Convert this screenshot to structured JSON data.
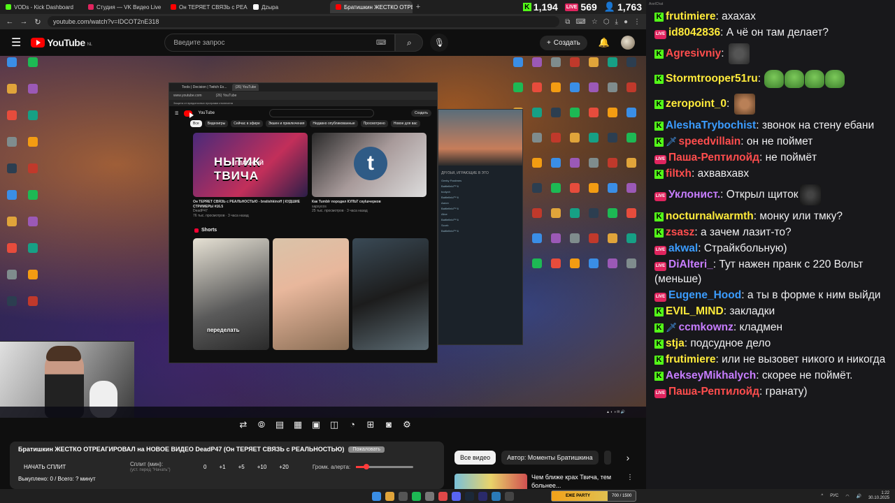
{
  "tabs": [
    {
      "label": "VODs - Kick Dashboard",
      "color": "#53fc18",
      "active": false
    },
    {
      "label": "Студия — VK Видео Live",
      "color": "#e0245e",
      "active": false
    },
    {
      "label": "Он ТЕРЯЕТ СВЯЗЬ с РЕАЛЬНОСТЬ",
      "color": "#ff0000",
      "active": false
    },
    {
      "label": "Дzырa",
      "color": "#ffffff",
      "active": false
    },
    {
      "label": "Братишкин ЖЕСТКО ОТРЕ",
      "color": "#ff0000",
      "active": true
    }
  ],
  "counters": {
    "kick": "1,194",
    "vk": "569",
    "viewers": "1,763",
    "vk_badge": "LIVE"
  },
  "address": {
    "url": "youtube.com/watch?v=IDCOT2nE318"
  },
  "youtube": {
    "logo": "YouTube",
    "region": "NL",
    "search_placeholder": "Введите запрос",
    "create_label": "Создать"
  },
  "inner_browser": {
    "tabs": [
      "Tools | Decision | Twitch Ex...",
      "(26) YouTube"
    ],
    "url": "www.youtube.com",
    "page_title": "(26) YouTube",
    "note": "Защита от вредоносных программ отключена",
    "chips": [
      "Все",
      "Видеоигры",
      "Сейчас в эфире",
      "Экшен и приключения",
      "Недавно опубликованные",
      "Просмотрено",
      "Новое для вас"
    ],
    "thumb1_text": "НЫТИК ТВИЧА",
    "thumb1_top": "ГЛАВНЫЙ",
    "video1_title": "Он ТЕРЯЕТ СВЯЗЬ с РЕАЛЬНОСТЬЮ - bratishkinoff | КУДШИЕ СТРИМЕРЫ #16.5",
    "video1_channel": "DeadP47",
    "video1_stats": "76 тыс. просмотров · 3 часа назад",
    "video2_title": "Как Tumblr породил КУЛЬТ скуlшчерков",
    "video2_channel": "sapsycos",
    "video2_stats": "25 тыс. просмотров · 3 часа назад",
    "shorts_label": "Shorts",
    "short_caption": "переделать"
  },
  "steam": {
    "heading": "ДРУЗЬЯ, ИГРАЮЩИЕ В ЭТО",
    "friends": [
      "Geeky Pastimes",
      "Battlefield™ 6",
      "bodych",
      "Battlefield™ 6",
      "Aaron",
      "Battlefield™ 6",
      "Alice",
      "Battlefield™ 6",
      "Scorb",
      "Battlefield™ 6"
    ]
  },
  "video": {
    "title": "Братишкин ЖЕСТКО ОТРЕАГИРОВАЛ на НОВОЕ ВИДЕО DeadP47 (Он ТЕРЯЕТ СВЯЗЬ с РЕАЛЬНОСТЬЮ)",
    "badge": "Пожаловать"
  },
  "split": {
    "start_label": "НАЧАТЬ СПЛИТ",
    "label": "Сплит (мин):",
    "sub": "(уст. перед \"Начать\")",
    "values": [
      "0",
      "+1",
      "+5",
      "+10",
      "+20"
    ],
    "alert_label": "Громк. алерта:",
    "alert_level": 0.18,
    "skip_text": "Выкуплено: 0 / Всего: ? минут"
  },
  "filters": {
    "all": "Все видео",
    "author": "Автор: Моменты Братишкина"
  },
  "recommended": {
    "title": "Чем ближе крах Твича, тем больнее..."
  },
  "chat": {
    "title": "AxelChat",
    "messages": [
      {
        "platform": "kick",
        "user": "frutimiere",
        "color": "#ffeb3b",
        "text": "ахахах"
      },
      {
        "platform": "vk",
        "user": "id8042836",
        "color": "#ffeb3b",
        "text": "А чё он там делает?"
      },
      {
        "platform": "kick",
        "user": "Agresivniy",
        "color": "#ff4d4d",
        "text": "",
        "emote": "dog"
      },
      {
        "platform": "kick",
        "user": "Stormtrooper51ru",
        "color": "#ffeb3b",
        "text": "",
        "emote": "frogs"
      },
      {
        "platform": "kick",
        "user": "zeropoint_0",
        "color": "#ffeb3b",
        "text": "",
        "emote": "face"
      },
      {
        "platform": "kick",
        "user": "AleshaTrybochist",
        "color": "#3b9cff",
        "text": "звонок на стену ебани"
      },
      {
        "platform": "kick",
        "user": "speedvillain",
        "color": "#ff4d4d",
        "text": "он не поймет",
        "sword": true
      },
      {
        "platform": "vk",
        "user": "Паша-Рептилойд",
        "color": "#ff4d4d",
        "text": "не поймёт"
      },
      {
        "platform": "kick",
        "user": "filtxh",
        "color": "#ff4d4d",
        "text": "ахвавхавх"
      },
      {
        "platform": "vk",
        "user": "Уклонист.",
        "color": "#c77dff",
        "text": "Открыл щиток",
        "emote": "dark"
      },
      {
        "platform": "kick",
        "user": "nocturnalwarmth",
        "color": "#ffeb3b",
        "text": "монку или тмку?"
      },
      {
        "platform": "kick",
        "user": "zsasz",
        "color": "#ff4d4d",
        "text": "а зачем лазит-то?"
      },
      {
        "platform": "vk",
        "user": "akwal",
        "color": "#3b9cff",
        "text": "Страйкбольную)"
      },
      {
        "platform": "vk",
        "user": "DiAlteri_",
        "color": "#c77dff",
        "text": "Тут нажен пранк с 220 Вольт (меньше)"
      },
      {
        "platform": "vk",
        "user": "Eugene_Hood",
        "color": "#3b9cff",
        "text": "а ты в форме к ним выйди"
      },
      {
        "platform": "kick",
        "user": "EVIL_MIND",
        "color": "#ffeb3b",
        "text": "закладки"
      },
      {
        "platform": "kick",
        "user": "ccmkownz",
        "color": "#c77dff",
        "text": "кладмен",
        "sword": true
      },
      {
        "platform": "kick",
        "user": "stja",
        "color": "#ffeb3b",
        "text": "подсудное дело"
      },
      {
        "platform": "kick",
        "user": "frutimiere",
        "color": "#ffeb3b",
        "text": "или не вызовет никого и никогда"
      },
      {
        "platform": "kick",
        "user": "AekseyMikhalych",
        "color": "#c77dff",
        "text": "скорее не поймёт."
      },
      {
        "platform": "vk",
        "user": "Паша-Рептилойд",
        "color": "#ff4d4d",
        "text": "гранату)"
      }
    ]
  },
  "taskbar": {
    "widget_label": "ЕЖЕ PARTY",
    "widget_count": "700 / 1500",
    "lang": "РУС",
    "time": "1:22",
    "date": "30.10.2025"
  }
}
